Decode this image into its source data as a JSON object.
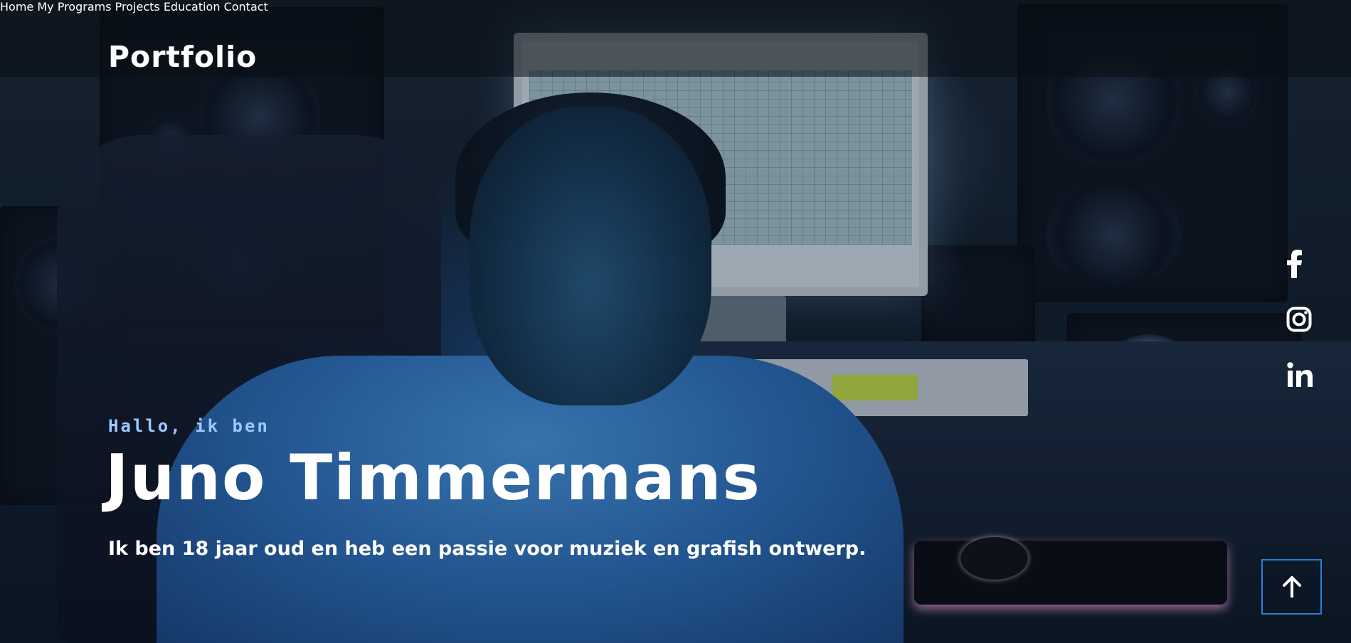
{
  "header": {
    "logo": "Portfolio",
    "nav": [
      {
        "label": "Home"
      },
      {
        "label": "My Programs"
      },
      {
        "label": "Projects"
      },
      {
        "label": "Education"
      },
      {
        "label": "Contact"
      }
    ]
  },
  "hero": {
    "greeting": "Hallo, ik ben",
    "name": "Juno Timmermans",
    "tagline": "Ik ben 18 jaar oud en heb een passie voor muziek en grafish ontwerp."
  },
  "social": [
    {
      "icon": "facebook-icon"
    },
    {
      "icon": "instagram-icon"
    },
    {
      "icon": "linkedin-icon"
    }
  ],
  "scroll_top": {
    "icon": "arrow-up-icon"
  },
  "colors": {
    "accent": "#9cc8ff",
    "button_border": "#2a7fd8",
    "text": "#ffffff"
  }
}
